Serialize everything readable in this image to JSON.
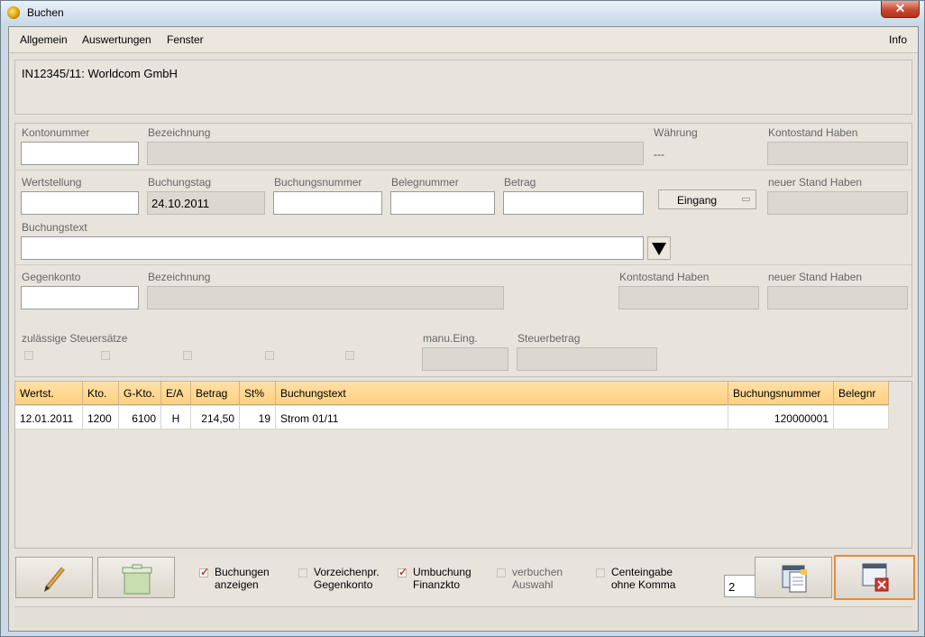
{
  "window": {
    "title": "Buchen",
    "close_label": "✕"
  },
  "menu": {
    "items": [
      "Allgemein",
      "Auswertungen",
      "Fenster"
    ],
    "info": "Info"
  },
  "header": {
    "account_text": "IN12345/11: Worldcom GmbH"
  },
  "form": {
    "kontonummer_label": "Kontonummer",
    "bezeichnung_label": "Bezeichnung",
    "waehrung_label": "Währung",
    "waehrung_value": "---",
    "kontostand_haben_label": "Kontostand Haben",
    "wertstellung_label": "Wertstellung",
    "buchungstag_label": "Buchungstag",
    "buchungstag_value": "24.10.2011",
    "buchungsnummer_label": "Buchungsnummer",
    "belegnummer_label": "Belegnummer",
    "betrag_label": "Betrag",
    "eingang_label": "Eingang",
    "neuer_stand_haben_label": "neuer Stand Haben",
    "buchungstext_label": "Buchungstext",
    "gegenkonto_label": "Gegenkonto",
    "bezeichnung2_label": "Bezeichnung",
    "kontostand_haben2_label": "Kontostand Haben",
    "neuer_stand_haben2_label": "neuer Stand Haben",
    "steuersaetze_label": "zulässige Steuersätze",
    "manu_eing_label": "manu.Eing.",
    "steuerbetrag_label": "Steuerbetrag"
  },
  "table": {
    "headers": [
      "Wertst.",
      "Kto.",
      "G-Kto.",
      "E/A",
      "Betrag",
      "St%",
      "Buchungstext",
      "Buchungsnummer",
      "Belegnr"
    ],
    "rows": [
      [
        "12.01.2011",
        "1200",
        "6100",
        "H",
        "214,50",
        "19",
        "Strom 01/11",
        "120000001",
        ""
      ]
    ]
  },
  "options": [
    {
      "label1": "Buchungen",
      "label2": "anzeigen",
      "checked": true
    },
    {
      "label1": "Vorzeichenpr.",
      "label2": "Gegenkonto",
      "checked": false
    },
    {
      "label1": "Umbuchung",
      "label2": "Finanzkto",
      "checked": true
    },
    {
      "label1": "verbuchen",
      "label2": "Auswahl",
      "checked": false
    },
    {
      "label1": "Centeingabe",
      "label2": "ohne Komma",
      "checked": false
    }
  ],
  "count_value": "2",
  "icons": {
    "edit": "pencil-icon",
    "delete": "trash-icon",
    "book": "save-document-icon",
    "close": "close-window-icon"
  }
}
